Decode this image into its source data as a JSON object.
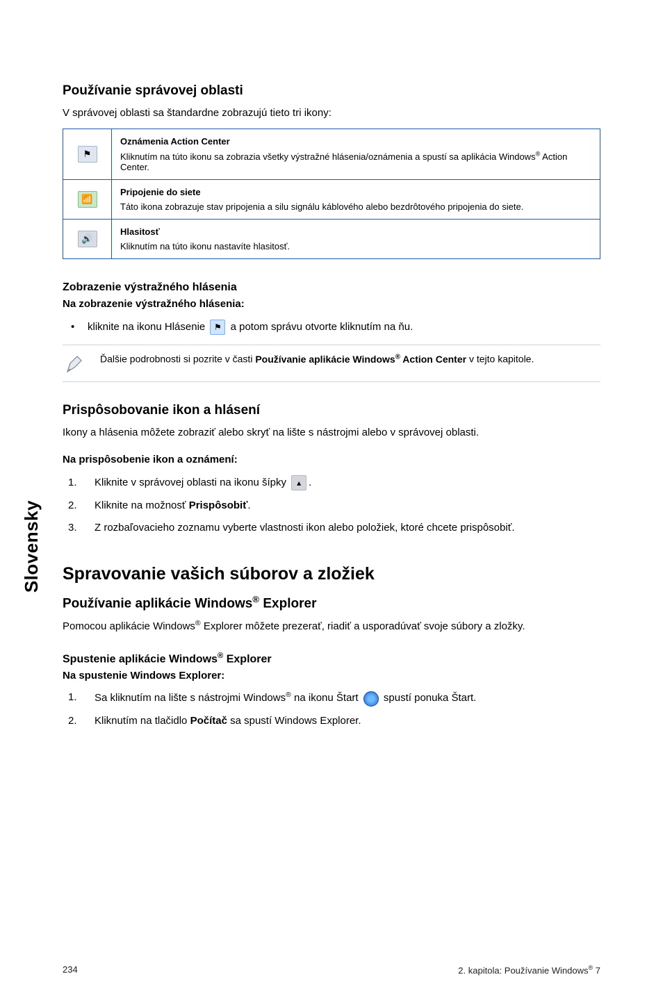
{
  "side_label": "Slovensky",
  "sec1": {
    "title": "Používanie správovej oblasti",
    "intro": "V správovej oblasti sa štandardne zobrazujú tieto tri ikony:"
  },
  "table_rows": [
    {
      "icon_glyph": "⚑",
      "icon_name": "flag-icon",
      "title": "Oznámenia Action Center",
      "desc_pre": "Kliknutím na túto ikonu sa zobrazia všetky výstražné hlásenia/oznámenia a spustí sa aplikácia Windows",
      "desc_post": " Action Center."
    },
    {
      "icon_glyph": "📶",
      "icon_name": "network-icon",
      "title": "Pripojenie do siete",
      "desc_pre": "Táto ikona zobrazuje stav pripojenia a silu signálu káblového alebo bezdrôtového pripojenia do siete.",
      "desc_post": ""
    },
    {
      "icon_glyph": "🔊",
      "icon_name": "volume-icon",
      "title": "Hlasitosť",
      "desc_pre": "Kliknutím na túto ikonu nastavíte hlasitosť.",
      "desc_post": ""
    }
  ],
  "warn": {
    "heading": "Zobrazenie výstražného hlásenia",
    "bold": "Na zobrazenie výstražného hlásenia:",
    "line_pre": "kliknite na ikonu Hlásenie ",
    "line_post": " a potom správu otvorte kliknutím na ňu."
  },
  "note": {
    "pre": "Ďalšie podrobnosti si pozrite v časti ",
    "bold_pre": "Používanie aplikácie Windows",
    "bold_post": " Action Center",
    "post": " v tejto kapitole."
  },
  "custom": {
    "title": "Prispôsobovanie ikon a hlásení",
    "intro": "Ikony a hlásenia môžete zobraziť alebo skryť na lište s nástrojmi alebo v správovej oblasti.",
    "bold": "Na prispôsobenie ikon a oznámení:",
    "step1_pre": "Kliknite v správovej oblasti na ikonu šípky ",
    "step1_post": ".",
    "step2_pre": "Kliknite na možnosť ",
    "step2_bold": "Prispôsobiť",
    "step2_post": ".",
    "step3": "Z rozbaľovacieho zoznamu vyberte vlastnosti ikon alebo položiek, ktoré chcete prispôsobiť."
  },
  "manage": {
    "title": "Spravovanie vašich súborov a zložiek",
    "sub1_pre": "Používanie aplikácie Windows",
    "sub1_post": " Explorer",
    "intro_pre": "Pomocou aplikácie Windows",
    "intro_post": " Explorer môžete prezerať, riadiť a usporadúvať svoje súbory a zložky.",
    "sub2_pre": "Spustenie aplikácie Windows",
    "sub2_post": " Explorer",
    "bold": "Na spustenie Windows Explorer:",
    "step1_pre": "Sa kliknutím na lište s nástrojmi Windows",
    "step1_mid": " na ikonu Štart ",
    "step1_post": " spustí ponuka Štart.",
    "step2_pre": "Kliknutím na tlačidlo ",
    "step2_bold": "Počítač",
    "step2_post": " sa spustí Windows Explorer."
  },
  "footer": {
    "left": "234",
    "right_pre": "2. kapitola: Používanie Windows",
    "right_post": " 7"
  }
}
